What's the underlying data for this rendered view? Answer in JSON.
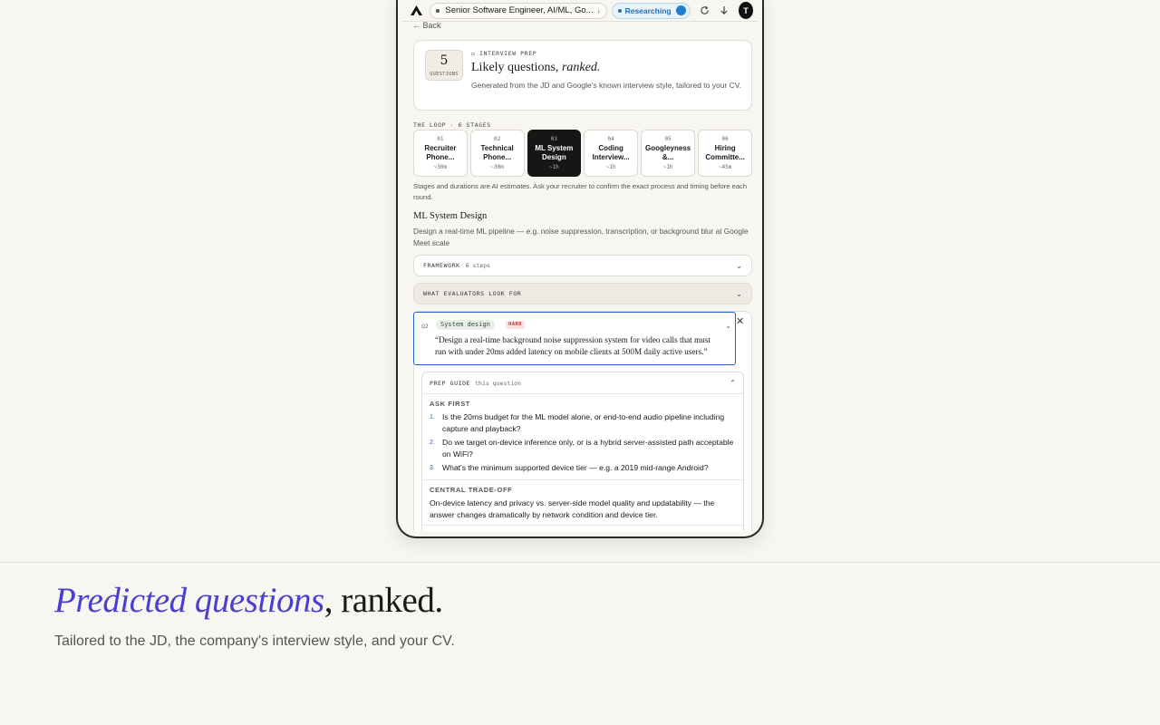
{
  "topbar": {
    "job_title": "Senior Software Engineer, AI/ML, Go...",
    "status": "Researching",
    "avatar_initial": "T"
  },
  "back_label": "← Back",
  "header": {
    "count": "5",
    "count_label": "QUESTIONS",
    "eyebrow": "INTERVIEW PREP",
    "title_plain": "Likely questions, ",
    "title_em": "ranked.",
    "subtitle": "Generated from the JD and Google's known interview style, tailored to your CV."
  },
  "loop": {
    "label": "THE LOOP · 6 STAGES",
    "stages": [
      {
        "num": "01",
        "name": "Recruiter Phone...",
        "duration": "~30m"
      },
      {
        "num": "02",
        "name": "Technical Phone...",
        "duration": "~30m"
      },
      {
        "num": "03",
        "name": "ML System Design",
        "duration": "~1h"
      },
      {
        "num": "04",
        "name": "Coding Interview...",
        "duration": "~1h"
      },
      {
        "num": "05",
        "name": "Googleyness &...",
        "duration": "~1h"
      },
      {
        "num": "06",
        "name": "Hiring Committe...",
        "duration": "~45m"
      }
    ],
    "active_index": 2,
    "disclaimer": "Stages and durations are AI estimates. Ask your recruiter to confirm the exact process and timing before each round."
  },
  "section": {
    "title": "ML System Design",
    "description": "Design a real-time ML pipeline — e.g. noise suppression, transcription, or background blur at Google Meet scale"
  },
  "accordions": {
    "framework_label": "FRAMEWORK",
    "framework_count": "6 steps",
    "evaluators_label": "WHAT EVALUATORS LOOK FOR"
  },
  "question": {
    "id": "Q2",
    "tag": "System design",
    "difficulty": "HARD",
    "text": "“Design a real-time background noise suppression system for video calls that must run with under 20ms added latency on mobile clients at 500M daily active users.”"
  },
  "prep_guide": {
    "label": "PREP GUIDE",
    "sub": "this question",
    "ask_first_title": "ASK FIRST",
    "ask_first": [
      "Is the 20ms budget for the ML model alone, or end-to-end audio pipeline including capture and playback?",
      "Do we target on-device inference only, or is a hybrid server-assisted path acceptable on WiFi?",
      "What's the minimum supported device tier — e.g. a 2019 mid-range Android?"
    ],
    "tradeoff_title": "CENTRAL TRADE-OFF",
    "tradeoff_text": "On-device latency and privacy vs. server-side model quality and updatability — the answer changes dramatically by network condition and device tier."
  },
  "caption": {
    "headline_em": "Predicted questions",
    "headline_rest": ", ranked.",
    "tagline": "Tailored to the JD, the company's interview style, and your CV."
  }
}
